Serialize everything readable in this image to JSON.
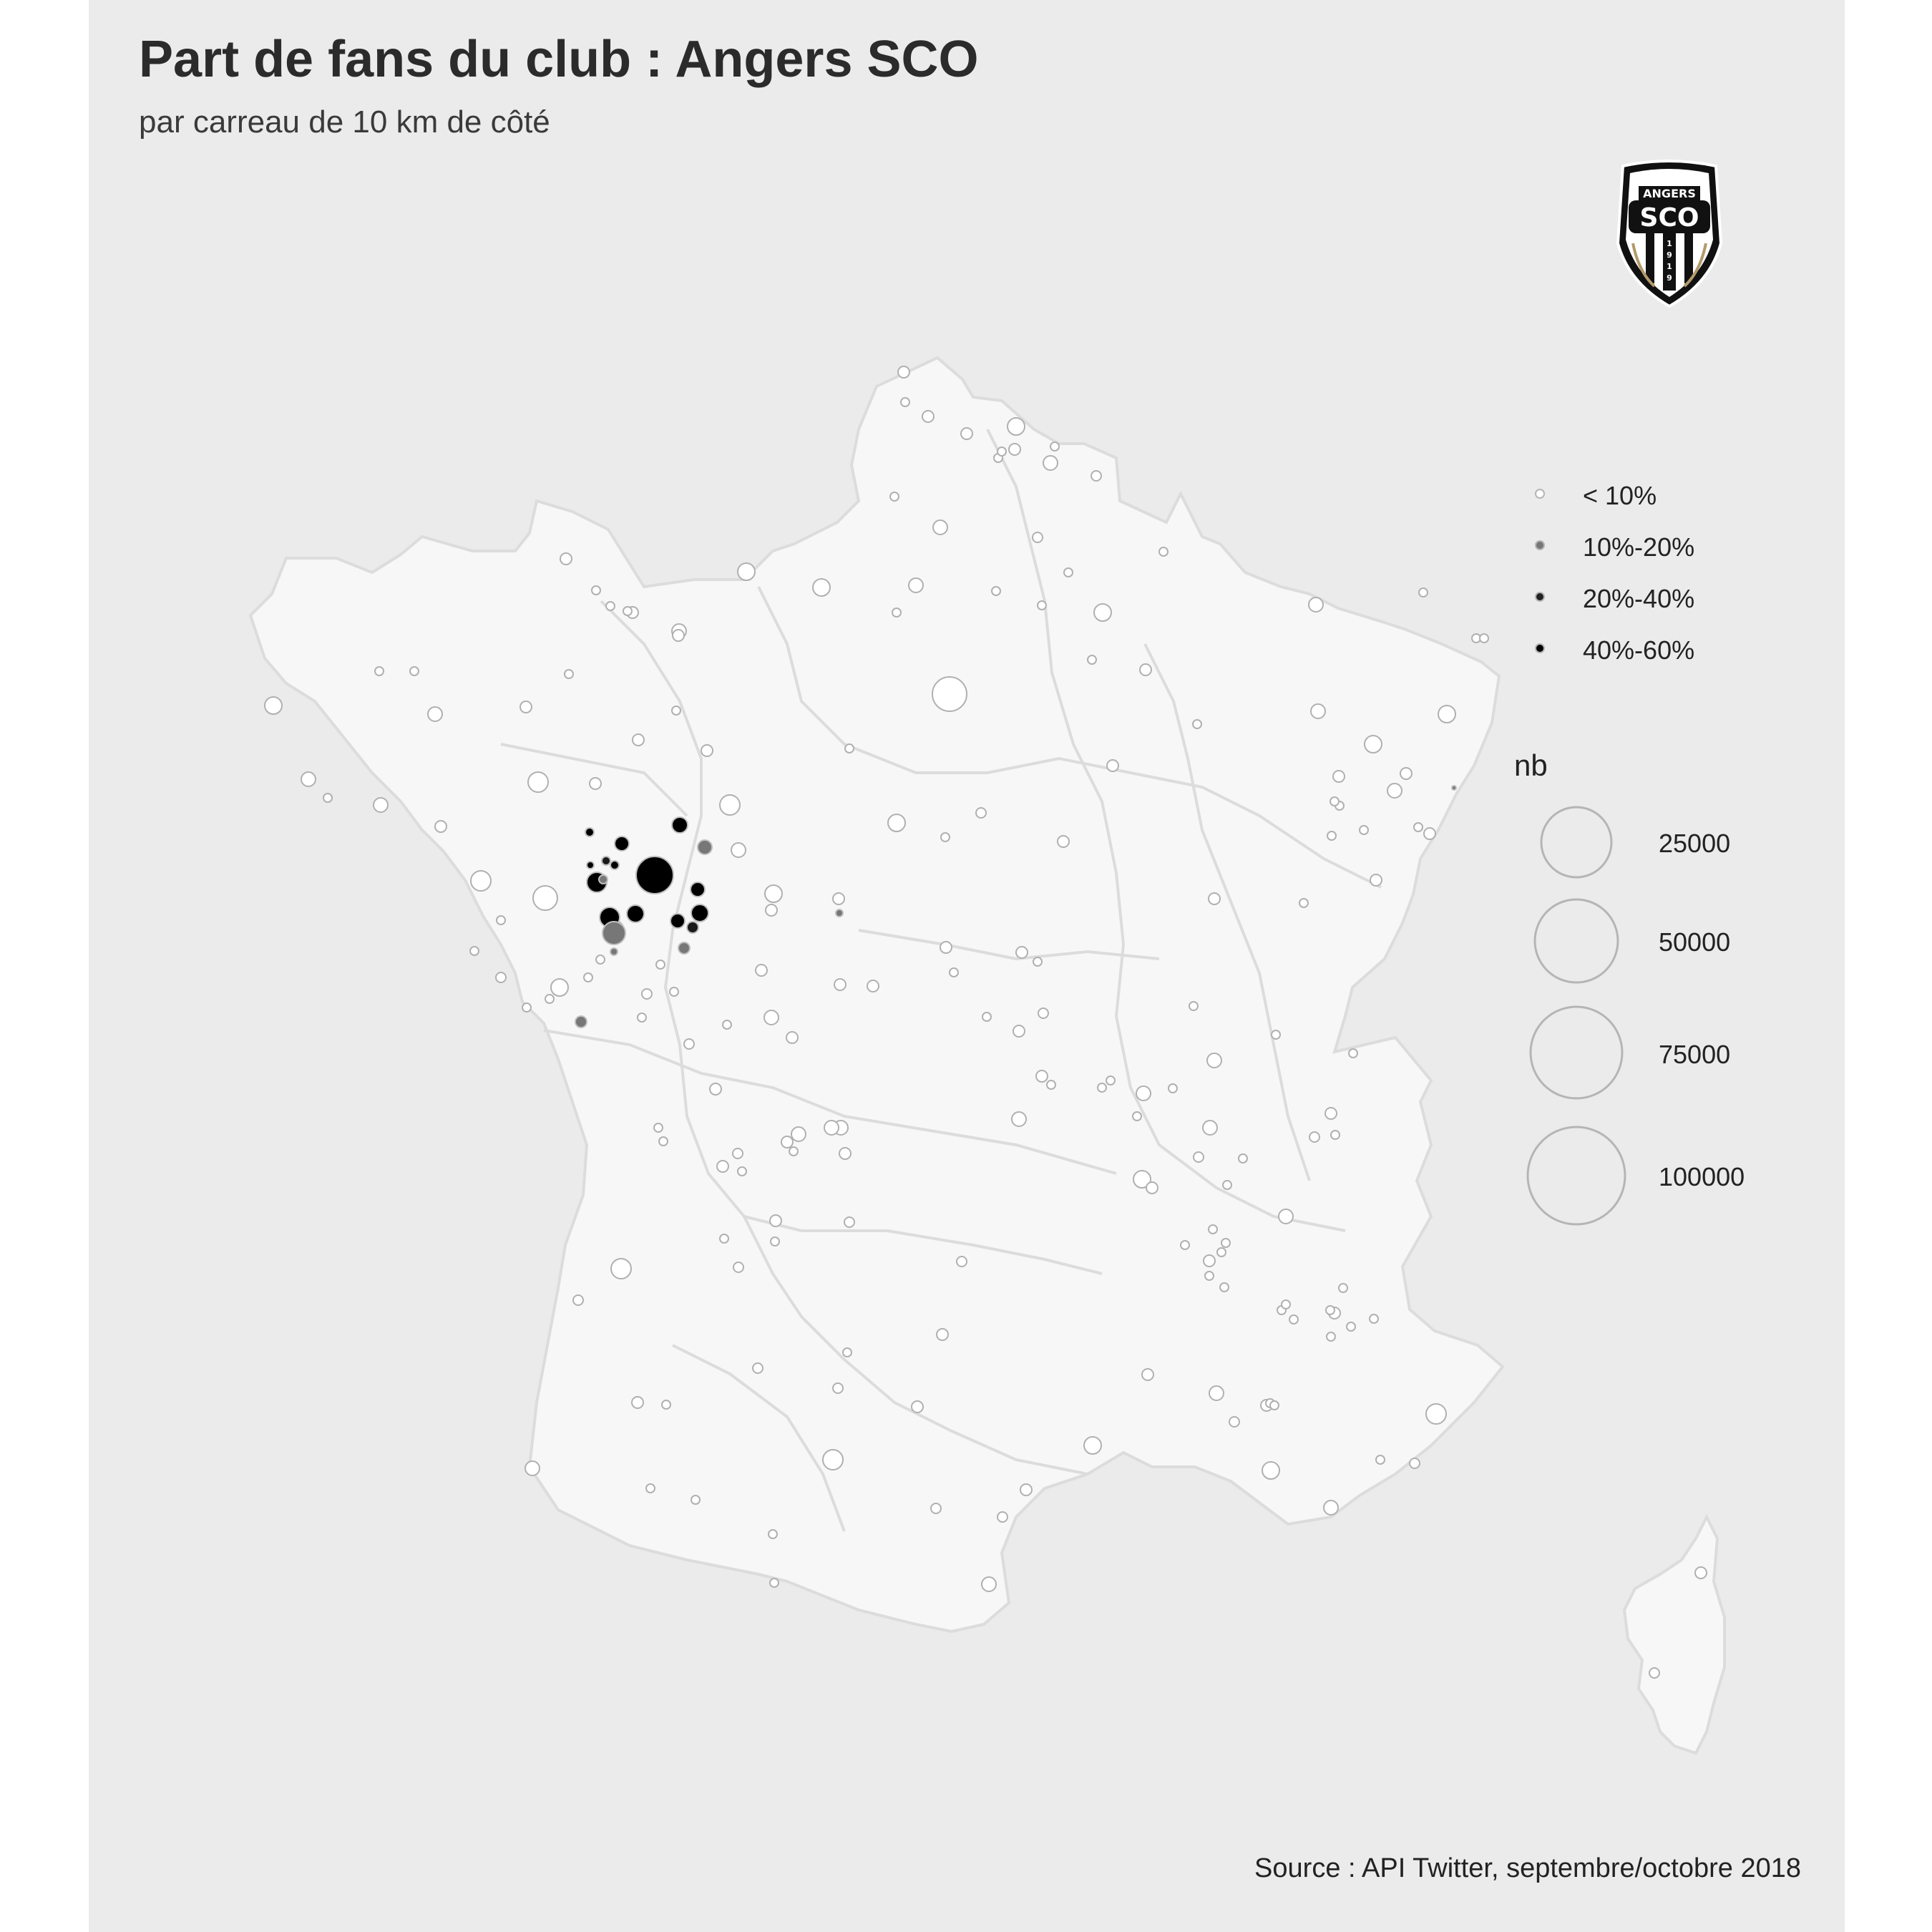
{
  "header": {
    "title": "Part de fans du club : Angers SCO",
    "subtitle": "par carreau de 10 km de côté"
  },
  "caption": "Source : API Twitter, septembre/octobre 2018",
  "logo": {
    "top_text": "ANGERS",
    "main_text": "SCO",
    "year_digits": [
      "1",
      "9",
      "1",
      "9"
    ]
  },
  "legend": {
    "share": {
      "categories": [
        {
          "label": "< 10%",
          "color": "#ffffff"
        },
        {
          "label": "10%-20%",
          "color": "#777777"
        },
        {
          "label": "20%-40%",
          "color": "#222222"
        },
        {
          "label": "40%-60%",
          "color": "#000000"
        }
      ]
    },
    "size": {
      "title": "nb",
      "values": [
        25000,
        50000,
        75000,
        100000
      ],
      "labels": [
        "25000",
        "50000",
        "75000",
        "100000"
      ]
    }
  },
  "colors": {
    "panel": "#ebebeb",
    "land": "#f7f7f7",
    "border": "#d9d9d9",
    "circle_stroke": "#b5b5b5"
  }
}
